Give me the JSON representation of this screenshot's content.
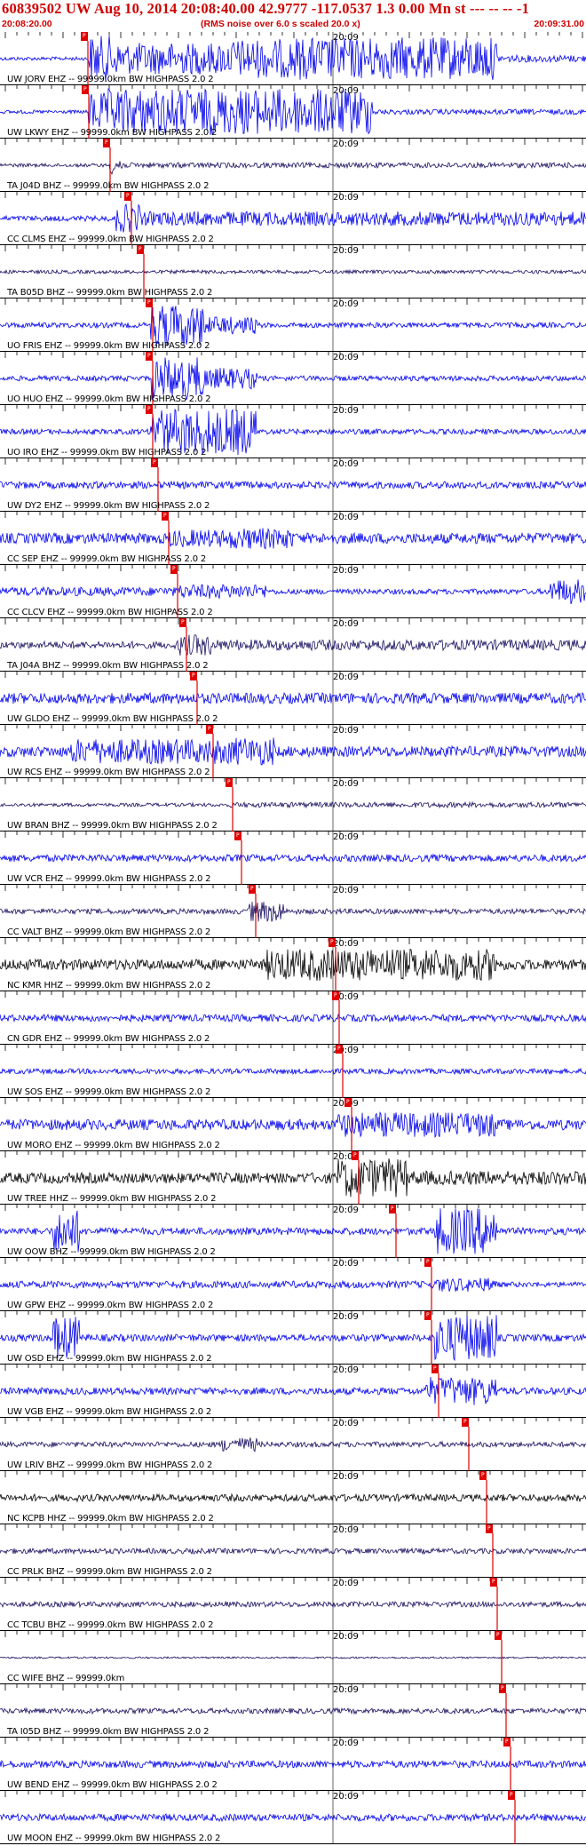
{
  "header": {
    "title": "60839502 UW Aug 10, 2014 20:08:40.00   42.9777 -117.0537  1.3 0.00 Mn st --- -- --  -1",
    "start_time": "20:08:20.00",
    "note": "(RMS noise over 6.0 s scaled 20.0 x)",
    "end_time": "20:09:31.00"
  },
  "colors": {
    "accent": "#d00000",
    "trace_blue": "#0000ee",
    "trace_navy": "#1a1060",
    "trace_black": "#000000",
    "pick_red": "#e00000"
  },
  "time_tick_label": "20:09",
  "pick_label": "P",
  "traces": [
    {
      "label": "UW JORV EHZ -- 99999.0km BW  HIGHPASS  2.0  2",
      "color": "blue"
    },
    {
      "label": "UW LKWY EHZ -- 99999.0km BW  HIGHPASS  2.0  2",
      "color": "blue"
    },
    {
      "label": "TA J04D BHZ -- 99999.0km BW  HIGHPASS  2.0  2",
      "color": "navy"
    },
    {
      "label": "CC CLMS EHZ -- 99999.0km BW  HIGHPASS  2.0  2",
      "color": "blue"
    },
    {
      "label": "TA B05D BHZ -- 99999.0km BW  HIGHPASS  2.0  2",
      "color": "navy"
    },
    {
      "label": "UO FRIS EHZ -- 99999.0km BW  HIGHPASS  2.0  2",
      "color": "blue"
    },
    {
      "label": "UO HUO EHZ -- 99999.0km BW  HIGHPASS  2.0  2",
      "color": "blue"
    },
    {
      "label": "UO IRO EHZ -- 99999.0km BW  HIGHPASS  2.0  2",
      "color": "blue"
    },
    {
      "label": "UW DY2 EHZ -- 99999.0km BW  HIGHPASS  2.0  2",
      "color": "blue"
    },
    {
      "label": "CC SEP EHZ -- 99999.0km BW  HIGHPASS  2.0  2",
      "color": "blue"
    },
    {
      "label": "CC CLCV EHZ -- 99999.0km BW  HIGHPASS  2.0  2",
      "color": "blue"
    },
    {
      "label": "TA J04A BHZ -- 99999.0km BW  HIGHPASS  2.0  2",
      "color": "navy"
    },
    {
      "label": "UW GLDO EHZ -- 99999.0km BW  HIGHPASS  2.0  2",
      "color": "blue"
    },
    {
      "label": "UW RCS EHZ -- 99999.0km BW  HIGHPASS  2.0  2",
      "color": "blue"
    },
    {
      "label": "UW BRAN BHZ -- 99999.0km BW  HIGHPASS  2.0  2",
      "color": "navy"
    },
    {
      "label": "UW VCR EHZ -- 99999.0km BW  HIGHPASS  2.0  2",
      "color": "blue"
    },
    {
      "label": "CC VALT BHZ -- 99999.0km BW  HIGHPASS  2.0  2",
      "color": "navy"
    },
    {
      "label": "NC KMR HHZ -- 99999.0km BW  HIGHPASS  2.0  2",
      "color": "black"
    },
    {
      "label": "CN GDR EHZ -- 99999.0km BW  HIGHPASS  2.0  2",
      "color": "blue"
    },
    {
      "label": "UW SOS EHZ -- 99999.0km BW  HIGHPASS  2.0  2",
      "color": "blue"
    },
    {
      "label": "UW MORO EHZ -- 99999.0km BW  HIGHPASS  2.0  2",
      "color": "blue"
    },
    {
      "label": "UW TREE HHZ -- 99999.0km BW  HIGHPASS  2.0  2",
      "color": "black"
    },
    {
      "label": "UW OOW BHZ -- 99999.0km BW  HIGHPASS  2.0  2",
      "color": "blue"
    },
    {
      "label": "UW GPW EHZ -- 99999.0km BW  HIGHPASS  2.0  2",
      "color": "blue"
    },
    {
      "label": "UW OSD EHZ -- 99999.0km BW  HIGHPASS  2.0  2",
      "color": "blue"
    },
    {
      "label": "UW VGB EHZ -- 99999.0km BW  HIGHPASS  2.0  2",
      "color": "blue"
    },
    {
      "label": "UW LRIV BHZ -- 99999.0km BW  HIGHPASS  2.0  2",
      "color": "navy"
    },
    {
      "label": "NC KCPB HHZ -- 99999.0km BW  HIGHPASS  2.0  2",
      "color": "black"
    },
    {
      "label": "CC PRLK BHZ -- 99999.0km BW  HIGHPASS  2.0  2",
      "color": "navy"
    },
    {
      "label": "CC TCBU BHZ -- 99999.0km BW  HIGHPASS  2.0  2",
      "color": "navy"
    },
    {
      "label": "CC WIFE BHZ -- 99999.0km",
      "color": "navy"
    },
    {
      "label": "TA I05D BHZ -- 99999.0km BW  HIGHPASS  2.0  2",
      "color": "navy"
    },
    {
      "label": "UW BEND EHZ -- 99999.0km BW  HIGHPASS  2.0  2",
      "color": "blue"
    },
    {
      "label": "UW MOON EHZ -- 99999.0km BW  HIGHPASS  2.0  2",
      "color": "blue"
    }
  ]
}
